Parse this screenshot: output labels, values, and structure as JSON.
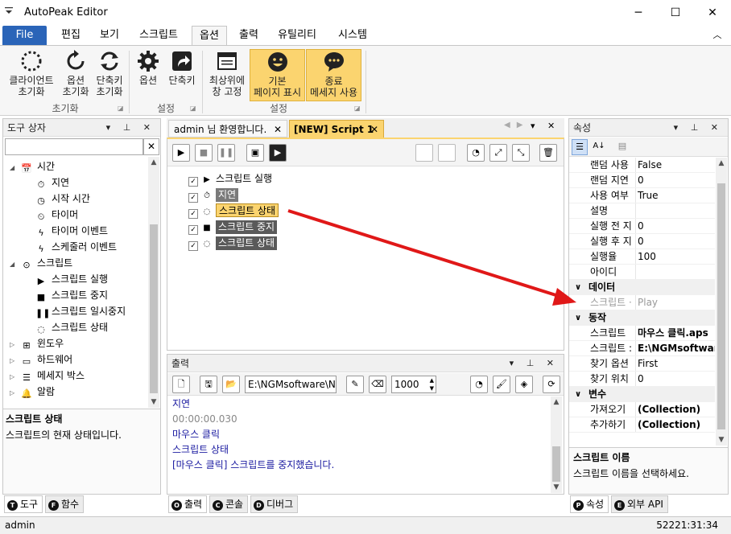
{
  "window": {
    "title": "AutoPeak Editor",
    "minimize": "─",
    "maximize": "☐",
    "close": "✕"
  },
  "menu": {
    "file": "File",
    "tabs": [
      "편집",
      "보기",
      "스크립트",
      "옵션",
      "출력",
      "유틸리티",
      "시스템"
    ],
    "collapse": "︿"
  },
  "ribbon": {
    "groups": [
      {
        "label": "초기화",
        "buttons": [
          {
            "l1": "클라이언트",
            "l2": "초기화"
          },
          {
            "l1": "옵션",
            "l2": "초기화"
          },
          {
            "l1": "단축키",
            "l2": "초기화"
          }
        ]
      },
      {
        "label": "설정",
        "buttons": [
          {
            "l1": "옵션",
            "l2": ""
          },
          {
            "l1": "단축키",
            "l2": ""
          }
        ]
      },
      {
        "label": "설정",
        "buttons": [
          {
            "l1": "최상위에",
            "l2": "창 고정"
          },
          {
            "l1": "기본",
            "l2": "페이지 표시"
          },
          {
            "l1": "종료",
            "l2": "메세지 사용"
          }
        ]
      }
    ]
  },
  "toolbox": {
    "title": "도구 상자",
    "search_value": "",
    "tree": [
      {
        "label": "시간",
        "icon": "calendar-icon",
        "level": 0,
        "expander": "◢"
      },
      {
        "label": "지연",
        "icon": "stopwatch-icon",
        "level": 1
      },
      {
        "label": "시작 시간",
        "icon": "clock-24-icon",
        "level": 1
      },
      {
        "label": "타이머",
        "icon": "alarm-timer-icon",
        "level": 1
      },
      {
        "label": "타이머 이벤트",
        "icon": "lightning-icon",
        "level": 1
      },
      {
        "label": "스케줄러 이벤트",
        "icon": "lightning-icon",
        "level": 1
      },
      {
        "label": "스크립트",
        "icon": "script-icon",
        "level": 0,
        "expander": "◢"
      },
      {
        "label": "스크립트 실행",
        "icon": "play-icon",
        "level": 1
      },
      {
        "label": "스크립트 중지",
        "icon": "stop-icon",
        "level": 1
      },
      {
        "label": "스크립트 일시중지",
        "icon": "pause-icon",
        "level": 1
      },
      {
        "label": "스크립트 상태",
        "icon": "status-spinner-icon",
        "level": 1
      },
      {
        "label": "윈도우",
        "icon": "windows-icon",
        "level": 0,
        "expander": "▷"
      },
      {
        "label": "하드웨어",
        "icon": "computer-icon",
        "level": 0,
        "expander": "▷"
      },
      {
        "label": "메세지 박스",
        "icon": "message-box-icon",
        "level": 0,
        "expander": "▷"
      },
      {
        "label": "알람",
        "icon": "bell-icon",
        "level": 0,
        "expander": "▷"
      }
    ],
    "desc_title": "스크립트 상태",
    "desc_text": "스크립트의 현재 상태입니다.",
    "tabs": [
      {
        "badge": "T",
        "label": "도구"
      },
      {
        "badge": "F",
        "label": "함수"
      }
    ]
  },
  "editor": {
    "tabs": [
      {
        "label": "admin 님 환영합니다.",
        "active": false
      },
      {
        "label": "[NEW] Script 1",
        "active": true
      }
    ],
    "rows": [
      {
        "label": "스크립트 실행",
        "icon": "▶",
        "style": "plain"
      },
      {
        "label": "지연",
        "icon": "⏱",
        "style": "grey"
      },
      {
        "label": "스크립트 상태",
        "icon": "◌",
        "style": "sel"
      },
      {
        "label": "스크립트 중지",
        "icon": "■",
        "style": "dark"
      },
      {
        "label": "스크립트 상태",
        "icon": "◌",
        "style": "dark"
      }
    ]
  },
  "output": {
    "title": "출력",
    "path": "E:\\NGMsoftware\\NG",
    "count": "1000",
    "lines": [
      {
        "text": "지연",
        "color": "#1a1aa0"
      },
      {
        "text": "00:00:00.030",
        "color": "#888888"
      },
      {
        "text": "마우스 클릭",
        "color": "#1a1aa0"
      },
      {
        "text": "스크립트 상태",
        "color": "#1a1aa0"
      },
      {
        "text": "[마우스 클릭] 스크립트를 중지했습니다.",
        "color": "#1a1aa0"
      }
    ],
    "tabs": [
      {
        "badge": "O",
        "label": "출력"
      },
      {
        "badge": "C",
        "label": "콘솔"
      },
      {
        "badge": "D",
        "label": "디버그"
      }
    ]
  },
  "properties": {
    "title": "속성",
    "items": [
      {
        "type": "row",
        "name": "랜덤 사용",
        "value": "False"
      },
      {
        "type": "row",
        "name": "랜덤 지연",
        "value": "0"
      },
      {
        "type": "row",
        "name": "사용 여부",
        "value": "True"
      },
      {
        "type": "row",
        "name": "설명",
        "value": ""
      },
      {
        "type": "row",
        "name": "실행 전 지",
        "value": "0"
      },
      {
        "type": "row",
        "name": "실행 후 지",
        "value": "0"
      },
      {
        "type": "row",
        "name": "실행율",
        "value": "100"
      },
      {
        "type": "row",
        "name": "아이디",
        "value": ""
      },
      {
        "type": "cat",
        "name": "데이터"
      },
      {
        "type": "row",
        "name": "스크립트 ·",
        "value": "Play",
        "dim": true
      },
      {
        "type": "cat",
        "name": "동작"
      },
      {
        "type": "row",
        "name": "스크립트",
        "value": "마우스 클릭.aps",
        "bold": true
      },
      {
        "type": "row",
        "name": "스크립트 : ",
        "value": "E:\\NGMsoftware",
        "bold": true
      },
      {
        "type": "row",
        "name": "찾기 옵션",
        "value": "First"
      },
      {
        "type": "row",
        "name": "찾기 위치",
        "value": "0"
      },
      {
        "type": "cat",
        "name": "변수"
      },
      {
        "type": "row",
        "name": "가져오기",
        "value": "(Collection)",
        "bold": true
      },
      {
        "type": "row",
        "name": "추가하기",
        "value": "(Collection)",
        "bold": true
      }
    ],
    "desc_title": "스크립트 이름",
    "desc_text": "스크립트 이름을 선택하세요.",
    "tabs": [
      {
        "badge": "P",
        "label": "속성"
      },
      {
        "badge": "E",
        "label": "외부 API"
      }
    ]
  },
  "status": {
    "user": "admin",
    "time": "52221:31:34"
  },
  "colors": {
    "accent": "#2a64b8",
    "highlight": "#fbd46f",
    "arrow": "#e01818"
  }
}
